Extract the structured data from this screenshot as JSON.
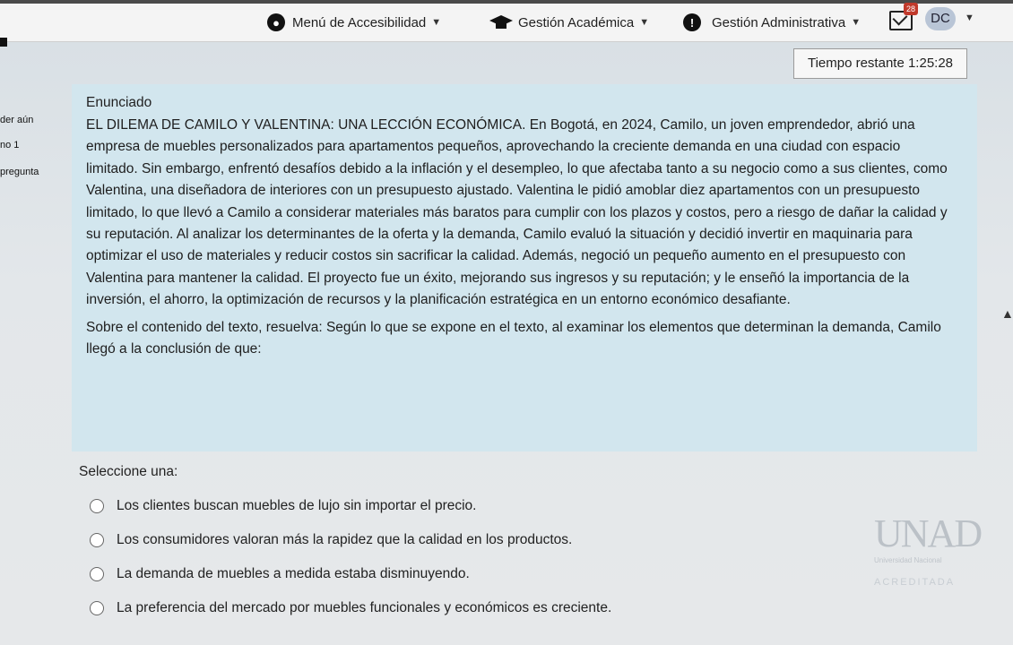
{
  "topbar": {
    "accessibility_label": "Menú de Accesibilidad",
    "academic_label": "Gestión Académica",
    "admin_label": "Gestión Administrativa",
    "message_count": "28",
    "user_initials": "DC"
  },
  "sidebar": {
    "line1": "der aún",
    "line2": "no 1",
    "line3": "pregunta"
  },
  "timer": {
    "label": "Tiempo restante 1:25:28"
  },
  "question": {
    "title": "Enunciado",
    "body": "EL DILEMA DE CAMILO Y VALENTINA: UNA LECCIÓN ECONÓMICA. En Bogotá, en 2024, Camilo, un joven emprendedor, abrió una empresa de muebles personalizados para apartamentos pequeños, aprovechando la creciente demanda en una ciudad con espacio limitado. Sin embargo, enfrentó desafíos debido a la inflación y el desempleo, lo que afectaba tanto a su negocio como a sus clientes, como Valentina, una diseñadora de interiores con un presupuesto ajustado. Valentina le pidió amoblar diez apartamentos con un presupuesto limitado, lo que llevó a Camilo a considerar materiales más baratos para cumplir con los plazos y costos, pero a riesgo de dañar la calidad y su reputación. Al analizar los determinantes de la oferta y la demanda, Camilo evaluó la situación y decidió invertir en maquinaria para optimizar el uso de materiales y reducir costos sin sacrificar la calidad. Además, negoció un pequeño aumento en el presupuesto con Valentina para mantener la calidad. El proyecto fue un éxito, mejorando sus ingresos y su reputación; y le enseñó la importancia de la inversión, el ahorro, la optimización de recursos y la planificación estratégica en un entorno económico desafiante.",
    "prompt": "Sobre el contenido del texto, resuelva: Según lo que se expone en el texto, al examinar los elementos que determinan la demanda, Camilo llegó a la conclusión de que:"
  },
  "answers": {
    "select_label": "Seleccione una:",
    "options": [
      "Los clientes buscan muebles de lujo sin importar el precio.",
      "Los consumidores valoran más la rapidez que la calidad en los productos.",
      "La demanda de muebles a medida estaba disminuyendo.",
      "La preferencia del mercado por muebles funcionales y económicos es creciente."
    ]
  },
  "logo": {
    "mark": "UNAD",
    "university": "Universidad Nacional",
    "accredited": "ACREDITADA"
  },
  "icons": [
    "accessibility-icon",
    "graduation-cap-icon",
    "alert-icon",
    "message-icon",
    "chevron-down-icon",
    "chevron-up-icon"
  ],
  "colors": {
    "question_bg": "#d2e6ee",
    "badge": "#c0392b",
    "avatar": "#b9c5d6"
  }
}
